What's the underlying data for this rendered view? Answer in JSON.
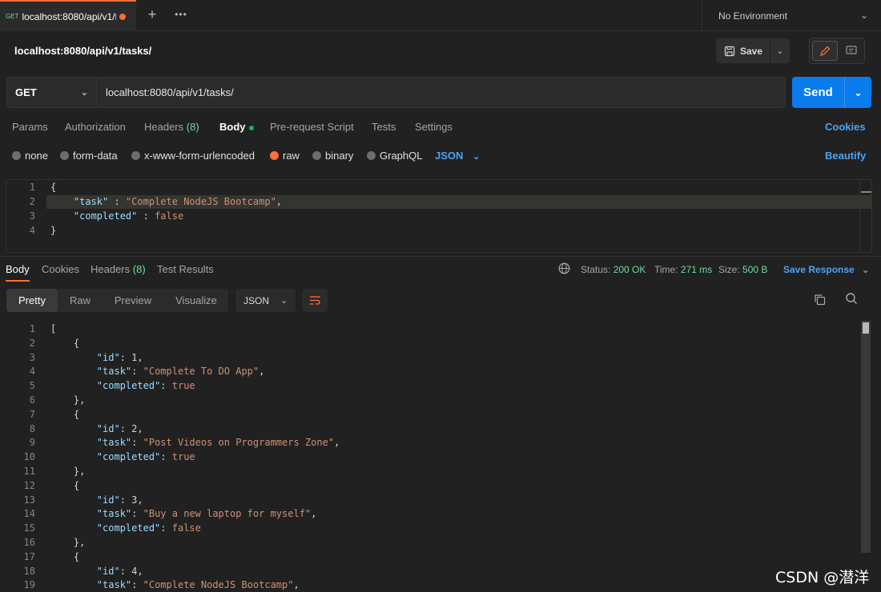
{
  "tab": {
    "method": "GET",
    "name": "localhost:8080/api/v1/t"
  },
  "environment": "No Environment",
  "request_title": "localhost:8080/api/v1/tasks/",
  "save_label": "Save",
  "method": "GET",
  "url": "localhost:8080/api/v1/tasks/",
  "send_label": "Send",
  "request_tabs": {
    "params": "Params",
    "authorization": "Authorization",
    "headers": "Headers",
    "headers_count": "(8)",
    "body": "Body",
    "prerequest": "Pre-request Script",
    "tests": "Tests",
    "settings": "Settings",
    "cookies": "Cookies"
  },
  "body_types": {
    "none": "none",
    "form_data": "form-data",
    "urlencoded": "x-www-form-urlencoded",
    "raw": "raw",
    "binary": "binary",
    "graphql": "GraphQL",
    "language": "JSON",
    "beautify": "Beautify"
  },
  "request_body": [
    {
      "n": "1",
      "t": "{"
    },
    {
      "n": "2",
      "t": "    \"task\" : \"Complete NodeJS Bootcamp\","
    },
    {
      "n": "3",
      "t": "    \"completed\" : false"
    },
    {
      "n": "4",
      "t": "}"
    }
  ],
  "response_tabs": {
    "body": "Body",
    "cookies": "Cookies",
    "headers": "Headers",
    "headers_count": "(8)",
    "test_results": "Test Results"
  },
  "status": {
    "status_label": "Status:",
    "status_value": "200 OK",
    "time_label": "Time:",
    "time_value": "271 ms",
    "size_label": "Size:",
    "size_value": "500 B",
    "save_response": "Save Response"
  },
  "view_modes": {
    "pretty": "Pretty",
    "raw": "Raw",
    "preview": "Preview",
    "visualize": "Visualize",
    "format": "JSON"
  },
  "response_body": [
    {
      "n": "1",
      "t": "["
    },
    {
      "n": "2",
      "t": "    {"
    },
    {
      "n": "3",
      "t": "        \"id\": 1,"
    },
    {
      "n": "4",
      "t": "        \"task\": \"Complete To DO App\","
    },
    {
      "n": "5",
      "t": "        \"completed\": true"
    },
    {
      "n": "6",
      "t": "    },"
    },
    {
      "n": "7",
      "t": "    {"
    },
    {
      "n": "8",
      "t": "        \"id\": 2,"
    },
    {
      "n": "9",
      "t": "        \"task\": \"Post Videos on Programmers Zone\","
    },
    {
      "n": "10",
      "t": "        \"completed\": true"
    },
    {
      "n": "11",
      "t": "    },"
    },
    {
      "n": "12",
      "t": "    {"
    },
    {
      "n": "13",
      "t": "        \"id\": 3,"
    },
    {
      "n": "14",
      "t": "        \"task\": \"Buy a new laptop for myself\","
    },
    {
      "n": "15",
      "t": "        \"completed\": false"
    },
    {
      "n": "16",
      "t": "    },"
    },
    {
      "n": "17",
      "t": "    {"
    },
    {
      "n": "18",
      "t": "        \"id\": 4,"
    },
    {
      "n": "19",
      "t": "        \"task\": \"Complete NodeJS Bootcamp\","
    }
  ],
  "watermark": "CSDN @潜洋"
}
